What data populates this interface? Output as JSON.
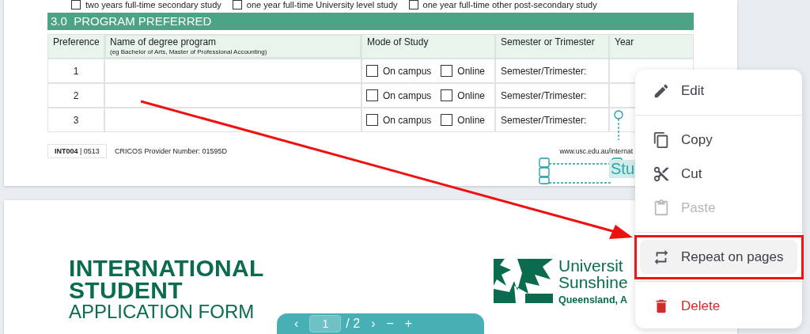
{
  "page_1": {
    "study_options": [
      {
        "label": "two years full-time secondary study",
        "checked": false
      },
      {
        "label": "one year full-time University level study",
        "checked": false
      },
      {
        "label": "one year full-time other post-secondary study",
        "checked": false
      }
    ],
    "section_title": "3.0  PROGRAM PREFERRED",
    "table": {
      "columns": [
        {
          "label": "Preference"
        },
        {
          "label": "Name of degree program",
          "note": "(eg Bachelor of Arts, Master of Professional Accounting)"
        },
        {
          "label": "Mode of Study"
        },
        {
          "label": "Semester or Trimester"
        },
        {
          "label": "Year"
        }
      ],
      "rows": [
        {
          "preference": "1",
          "modes": [
            {
              "label": "On campus",
              "checked": false
            },
            {
              "label": "Online",
              "checked": false
            }
          ],
          "semester": "Semester/Trimester:"
        },
        {
          "preference": "2",
          "modes": [
            {
              "label": "On campus",
              "checked": false
            },
            {
              "label": "Online",
              "checked": false
            }
          ],
          "semester": "Semester/Trimester:"
        },
        {
          "preference": "3",
          "modes": [
            {
              "label": "On campus",
              "checked": false
            },
            {
              "label": "Online",
              "checked": false
            }
          ],
          "semester": "Semester/Trimester:"
        }
      ]
    },
    "footer": {
      "form_code": "**INT004** | 0513",
      "provider": "CRICOS Provider Number: 01595D",
      "website": "www.usc.edu.au/internat"
    }
  },
  "selected_element": {
    "text": "Stu"
  },
  "page_2": {
    "title_lines": [
      "INTERNATIONAL",
      "STUDENT"
    ],
    "subtitle": "APPLICATION FORM",
    "logo_lines": [
      "Universit",
      "Sunshine",
      "Queensland, A"
    ]
  },
  "context_menu": {
    "items": [
      {
        "kind": "edit",
        "label": "Edit",
        "disabled": false,
        "selected": false
      },
      {
        "kind": "divider"
      },
      {
        "kind": "copy",
        "label": "Copy",
        "disabled": false,
        "selected": false
      },
      {
        "kind": "cut",
        "label": "Cut",
        "disabled": false,
        "selected": false
      },
      {
        "kind": "paste",
        "label": "Paste",
        "disabled": true,
        "selected": false
      },
      {
        "kind": "divider"
      },
      {
        "kind": "repeat",
        "label": "Repeat on pages",
        "disabled": false,
        "selected": true
      },
      {
        "kind": "divider"
      },
      {
        "kind": "delete",
        "label": "Delete",
        "disabled": false,
        "selected": false
      }
    ]
  },
  "pager": {
    "previous": "‹",
    "page": "1",
    "total": "/ 2",
    "next": "›",
    "zoom_out": "−",
    "zoom_in": "+"
  }
}
